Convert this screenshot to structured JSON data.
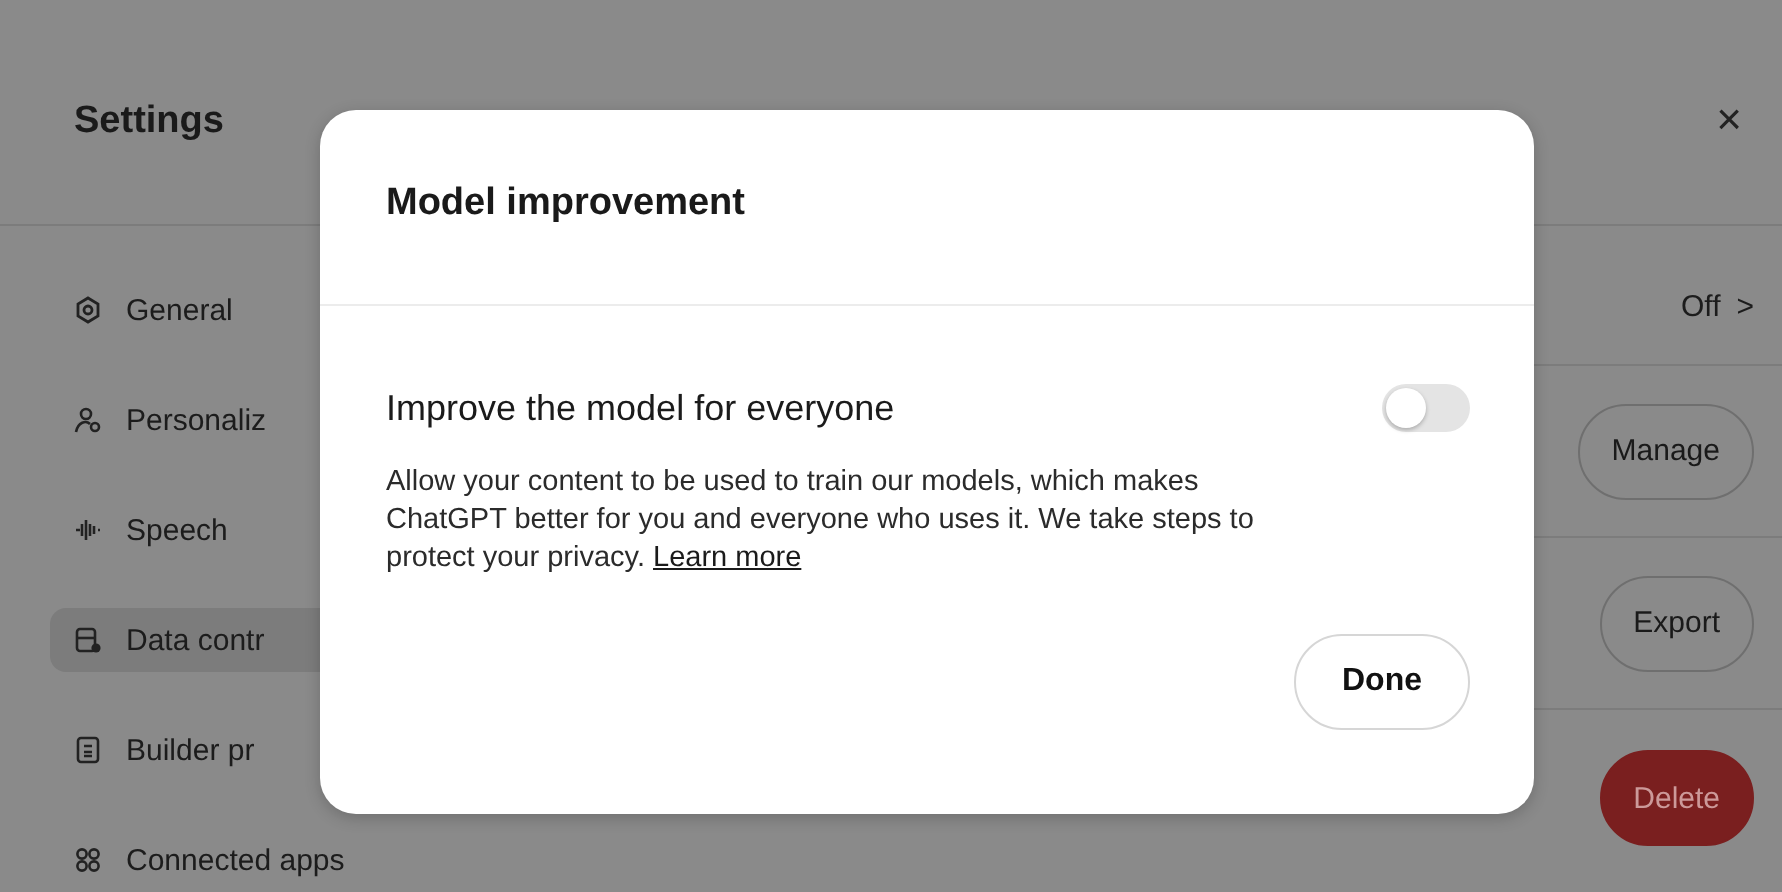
{
  "settings": {
    "title": "Settings",
    "close": "×",
    "sidebar": {
      "items": [
        {
          "label": "General",
          "selected": false
        },
        {
          "label": "Personaliz",
          "selected": false
        },
        {
          "label": "Speech",
          "selected": false
        },
        {
          "label": "Data contr",
          "selected": true
        },
        {
          "label": "Builder pr",
          "selected": false
        },
        {
          "label": "Connected apps",
          "selected": false
        }
      ]
    },
    "rows": [
      {
        "kind": "value",
        "value": "Off",
        "chevron": ">"
      },
      {
        "kind": "button",
        "label": "Manage"
      },
      {
        "kind": "button",
        "label": "Export"
      },
      {
        "kind": "danger",
        "label": "Delete"
      }
    ]
  },
  "dialog": {
    "title": "Model improvement",
    "setting": {
      "label": "Improve the model for everyone",
      "on": false
    },
    "description": "Allow your content to be used to train our models, which makes ChatGPT better for you and everyone who uses it. We take steps to protect your privacy.",
    "link": "Learn more",
    "button": "Done"
  }
}
